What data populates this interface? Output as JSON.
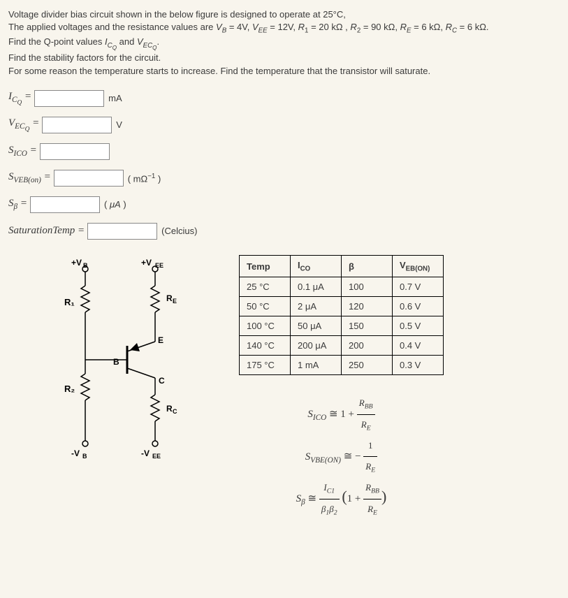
{
  "problem": {
    "line1_a": "Voltage divider bias circuit shown in the below figure is designed to operate at 25°C,",
    "line2_a": "The applied voltages and the resistance values are ",
    "params": "V_B = 4V, V_EE = 12V, R_1 = 20 kΩ, R_2 = 90 kΩ, R_E = 6 kΩ, R_C = 6 kΩ.",
    "line3": "Find the Q-point values I_CQ and V_ECQ.",
    "line4": "Find the stability factors for the circuit.",
    "line5": "For some reason the temperature starts to increase. Find the temperature that the transistor will saturate."
  },
  "answers": {
    "icq_label": "I",
    "icq_sub": "C_Q",
    "icq_unit": "mA",
    "vecq_label": "V",
    "vecq_sub": "EC_Q",
    "vecq_unit": "V",
    "sico_label": "S",
    "sico_sub": "ICO",
    "svebon_label": "S",
    "svebon_sub": "VEB(on)",
    "svebon_unit": "( mΩ−1 )",
    "sbeta_label": "S",
    "sbeta_sub": "β",
    "sbeta_unit": "( μA )",
    "sattemp_label": "SaturationTemp",
    "sattemp_unit": "(Celcius)"
  },
  "circuit": {
    "vb_plus": "+V_B",
    "vee_plus": "+V_EE",
    "r1": "R₁",
    "r2": "R₂",
    "re": "R_E",
    "rc": "R_C",
    "b": "B",
    "e": "E",
    "c": "C",
    "vb_minus": "-V_B",
    "vee_minus": "-V_EE"
  },
  "table": {
    "headers": [
      "Temp",
      "I_CO",
      "β",
      "V_EB(ON)"
    ],
    "rows": [
      [
        "25 °C",
        "0.1 μA",
        "100",
        "0.7 V"
      ],
      [
        "50 °C",
        "2 μA",
        "120",
        "0.6 V"
      ],
      [
        "100 °C",
        "50 μA",
        "150",
        "0.5 V"
      ],
      [
        "140 °C",
        "200 μA",
        "200",
        "0.4 V"
      ],
      [
        "175 °C",
        "1 mA",
        "250",
        "0.3 V"
      ]
    ]
  },
  "formulas": {
    "f1_lhs": "S_ICO",
    "f1_rhs_a": "1 +",
    "f1_frac_top": "R_BB",
    "f1_frac_bot": "R_E",
    "f2_lhs": "S_VBE(ON)",
    "f2_rhs": "−",
    "f2_frac_top": "1",
    "f2_frac_bot": "R_E",
    "f3_lhs": "S_β",
    "f3_frac1_top": "I_C1",
    "f3_frac1_bot": "β₁β₂",
    "f3_mid": "(1 +",
    "f3_frac2_top": "R_BB",
    "f3_frac2_bot": "R_E",
    "f3_end": ")"
  }
}
